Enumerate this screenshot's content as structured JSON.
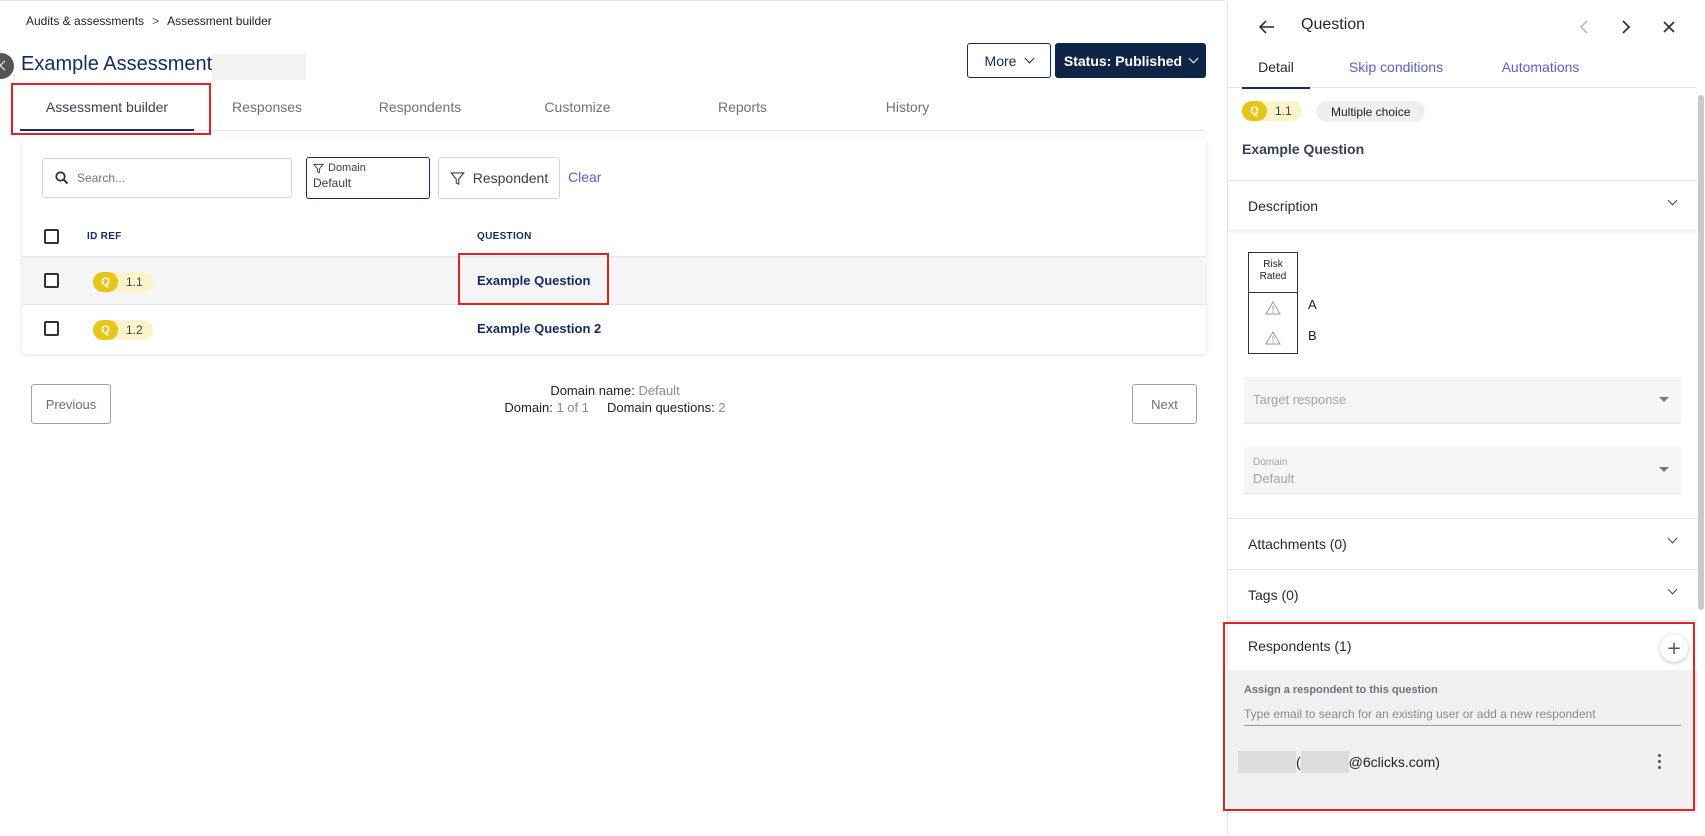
{
  "breadcrumb": {
    "items": [
      "Audits & assessments",
      "Assessment builder"
    ],
    "separator": ">"
  },
  "page": {
    "title": "Example Assessment"
  },
  "header": {
    "more_label": "More",
    "status_label": "Status: Published"
  },
  "tabs": [
    {
      "label": "Assessment builder",
      "active": true
    },
    {
      "label": "Responses"
    },
    {
      "label": "Respondents"
    },
    {
      "label": "Customize"
    },
    {
      "label": "Reports"
    },
    {
      "label": "History"
    }
  ],
  "filters": {
    "search_placeholder": "Search...",
    "domain_label": "Domain",
    "domain_value": "Default",
    "respondent_label": "Respondent",
    "clear_label": "Clear"
  },
  "table": {
    "columns": [
      "ID REF",
      "QUESTION"
    ],
    "rows": [
      {
        "q": "Q",
        "id": "1.1",
        "question": "Example Question",
        "selected": true
      },
      {
        "q": "Q",
        "id": "1.2",
        "question": "Example Question 2"
      }
    ]
  },
  "pager": {
    "prev_label": "Previous",
    "next_label": "Next",
    "domain_name_label": "Domain name:",
    "domain_name": "Default",
    "domain_label": "Domain:",
    "domain_pos": "1 of 1",
    "questions_label": "Domain questions:",
    "questions_count": "2"
  },
  "panel": {
    "title": "Question",
    "tabs": [
      {
        "label": "Detail",
        "active": true
      },
      {
        "label": "Skip conditions"
      },
      {
        "label": "Automations"
      }
    ],
    "badge_q": "Q",
    "badge_id": "1.1",
    "type": "Multiple choice",
    "question_name": "Example Question",
    "sections": {
      "description": "Description",
      "attachments": "Attachments (0)",
      "tags": "Tags (0)",
      "respondents": "Respondents (1)"
    },
    "risk": {
      "header": [
        "Risk",
        "Rated"
      ],
      "options": [
        "A",
        "B"
      ]
    },
    "target_response_placeholder": "Target response",
    "domain_field": {
      "label": "Domain",
      "value": "Default"
    },
    "respondents_box": {
      "assign_label": "Assign a respondent to this question",
      "input_placeholder": "Type email to search for an existing user or add a new respondent",
      "respondent_open": "(",
      "respondent_email_suffix": "@6clicks.com)"
    }
  },
  "colors": {
    "brand": "#0f2548",
    "accent": "#5b5fc7",
    "highlight": "#e02424",
    "badge": "#e6c619"
  }
}
